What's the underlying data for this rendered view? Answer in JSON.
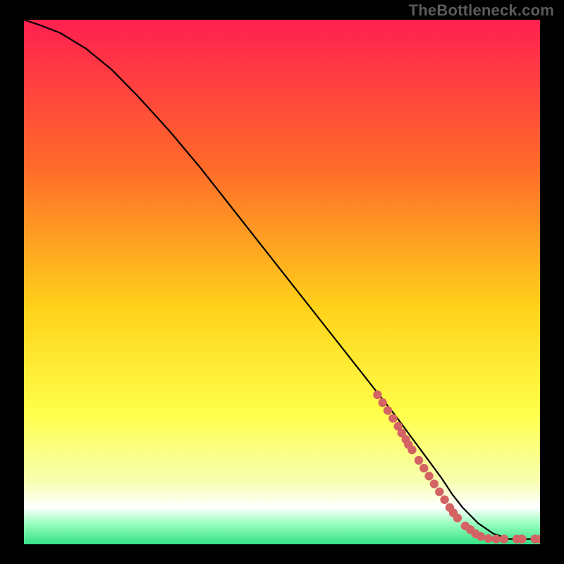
{
  "watermark": "TheBottleneck.com",
  "colors": {
    "grad_top": "#ff2050",
    "grad_mid1": "#ff6a2a",
    "grad_mid2": "#ffd21a",
    "grad_mid3": "#ffff4a",
    "grad_mid4": "#f7ffb0",
    "grad_bottom_cream": "#ffffff",
    "grad_green": "#35e185",
    "curve": "#000000",
    "dots": "#d46464"
  },
  "chart_data": {
    "type": "line",
    "title": "",
    "xlabel": "",
    "ylabel": "",
    "xlim": [
      0,
      100
    ],
    "ylim": [
      0,
      100
    ],
    "curve_note": "Monotonic decreasing curve; plateaus near zero for high x. Values estimated from pixels (0-100 normalized axes).",
    "series": [
      {
        "name": "bottleneck-curve",
        "x": [
          0,
          3,
          7,
          12,
          17,
          22,
          28,
          34,
          40,
          46,
          52,
          58,
          64,
          68,
          72,
          75,
          78,
          81,
          83,
          85,
          88,
          91,
          94,
          97,
          100
        ],
        "y": [
          100,
          99,
          97.5,
          94.5,
          90.5,
          85.5,
          79,
          72,
          64.5,
          57,
          49.5,
          42,
          34.5,
          29.5,
          24.5,
          20.5,
          16.5,
          12.5,
          9.5,
          7,
          4,
          2,
          1,
          1,
          1
        ]
      }
    ],
    "scatter": {
      "note": "Highlighted sample points along lower-right portion of curve (x,y normalized 0-100).",
      "points": [
        [
          68.5,
          28.5
        ],
        [
          69.5,
          27
        ],
        [
          70.5,
          25.5
        ],
        [
          71.5,
          24
        ],
        [
          72.5,
          22.5
        ],
        [
          73.2,
          21.2
        ],
        [
          74,
          20
        ],
        [
          74.5,
          19
        ],
        [
          75.2,
          18
        ],
        [
          76.5,
          16
        ],
        [
          77.5,
          14.5
        ],
        [
          78.5,
          13
        ],
        [
          79.5,
          11.5
        ],
        [
          80.5,
          10
        ],
        [
          81.5,
          8.5
        ],
        [
          82.5,
          7
        ],
        [
          83.2,
          6
        ],
        [
          84,
          5
        ],
        [
          85.5,
          3.5
        ],
        [
          86.5,
          2.8
        ],
        [
          87.5,
          2
        ],
        [
          88.5,
          1.5
        ],
        [
          90,
          1.1
        ],
        [
          91.5,
          1
        ],
        [
          93,
          1
        ],
        [
          95.5,
          1
        ],
        [
          96.5,
          1
        ],
        [
          99,
          1
        ],
        [
          100,
          1
        ]
      ]
    }
  }
}
